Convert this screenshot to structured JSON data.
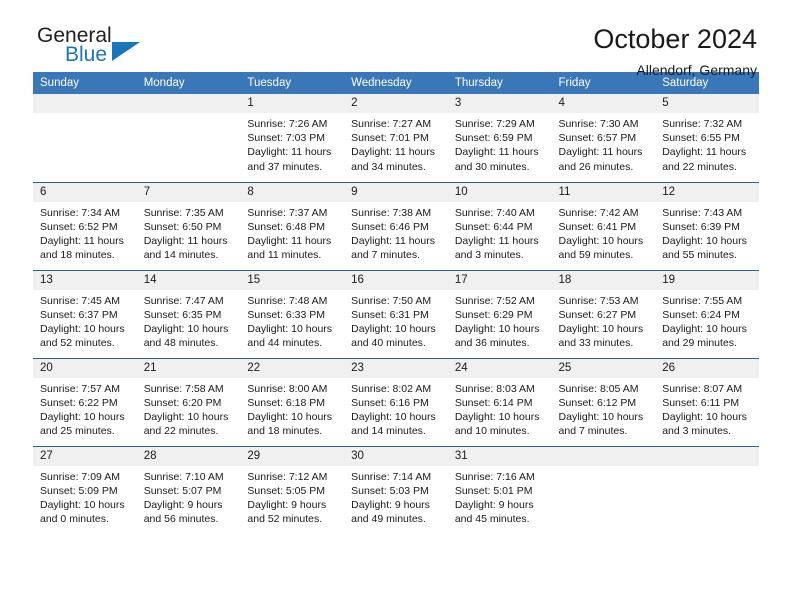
{
  "brand": {
    "name_part1": "General",
    "name_part2": "Blue",
    "accent_color": "#1b75bb",
    "triangle_icon": "triangle-icon"
  },
  "header": {
    "title": "October 2024",
    "subtitle": "Allendorf, Germany"
  },
  "calendar": {
    "header_background": "#3a77b8",
    "weekday_headers": [
      "Sunday",
      "Monday",
      "Tuesday",
      "Wednesday",
      "Thursday",
      "Friday",
      "Saturday"
    ],
    "weeks": [
      [
        {
          "day": "",
          "sunrise": "",
          "sunset": "",
          "daylight": "",
          "empty": true
        },
        {
          "day": "",
          "sunrise": "",
          "sunset": "",
          "daylight": "",
          "empty": true
        },
        {
          "day": "1",
          "sunrise": "Sunrise: 7:26 AM",
          "sunset": "Sunset: 7:03 PM",
          "daylight": "Daylight: 11 hours and 37 minutes."
        },
        {
          "day": "2",
          "sunrise": "Sunrise: 7:27 AM",
          "sunset": "Sunset: 7:01 PM",
          "daylight": "Daylight: 11 hours and 34 minutes."
        },
        {
          "day": "3",
          "sunrise": "Sunrise: 7:29 AM",
          "sunset": "Sunset: 6:59 PM",
          "daylight": "Daylight: 11 hours and 30 minutes."
        },
        {
          "day": "4",
          "sunrise": "Sunrise: 7:30 AM",
          "sunset": "Sunset: 6:57 PM",
          "daylight": "Daylight: 11 hours and 26 minutes."
        },
        {
          "day": "5",
          "sunrise": "Sunrise: 7:32 AM",
          "sunset": "Sunset: 6:55 PM",
          "daylight": "Daylight: 11 hours and 22 minutes."
        }
      ],
      [
        {
          "day": "6",
          "sunrise": "Sunrise: 7:34 AM",
          "sunset": "Sunset: 6:52 PM",
          "daylight": "Daylight: 11 hours and 18 minutes."
        },
        {
          "day": "7",
          "sunrise": "Sunrise: 7:35 AM",
          "sunset": "Sunset: 6:50 PM",
          "daylight": "Daylight: 11 hours and 14 minutes."
        },
        {
          "day": "8",
          "sunrise": "Sunrise: 7:37 AM",
          "sunset": "Sunset: 6:48 PM",
          "daylight": "Daylight: 11 hours and 11 minutes."
        },
        {
          "day": "9",
          "sunrise": "Sunrise: 7:38 AM",
          "sunset": "Sunset: 6:46 PM",
          "daylight": "Daylight: 11 hours and 7 minutes."
        },
        {
          "day": "10",
          "sunrise": "Sunrise: 7:40 AM",
          "sunset": "Sunset: 6:44 PM",
          "daylight": "Daylight: 11 hours and 3 minutes."
        },
        {
          "day": "11",
          "sunrise": "Sunrise: 7:42 AM",
          "sunset": "Sunset: 6:41 PM",
          "daylight": "Daylight: 10 hours and 59 minutes."
        },
        {
          "day": "12",
          "sunrise": "Sunrise: 7:43 AM",
          "sunset": "Sunset: 6:39 PM",
          "daylight": "Daylight: 10 hours and 55 minutes."
        }
      ],
      [
        {
          "day": "13",
          "sunrise": "Sunrise: 7:45 AM",
          "sunset": "Sunset: 6:37 PM",
          "daylight": "Daylight: 10 hours and 52 minutes."
        },
        {
          "day": "14",
          "sunrise": "Sunrise: 7:47 AM",
          "sunset": "Sunset: 6:35 PM",
          "daylight": "Daylight: 10 hours and 48 minutes."
        },
        {
          "day": "15",
          "sunrise": "Sunrise: 7:48 AM",
          "sunset": "Sunset: 6:33 PM",
          "daylight": "Daylight: 10 hours and 44 minutes."
        },
        {
          "day": "16",
          "sunrise": "Sunrise: 7:50 AM",
          "sunset": "Sunset: 6:31 PM",
          "daylight": "Daylight: 10 hours and 40 minutes."
        },
        {
          "day": "17",
          "sunrise": "Sunrise: 7:52 AM",
          "sunset": "Sunset: 6:29 PM",
          "daylight": "Daylight: 10 hours and 36 minutes."
        },
        {
          "day": "18",
          "sunrise": "Sunrise: 7:53 AM",
          "sunset": "Sunset: 6:27 PM",
          "daylight": "Daylight: 10 hours and 33 minutes."
        },
        {
          "day": "19",
          "sunrise": "Sunrise: 7:55 AM",
          "sunset": "Sunset: 6:24 PM",
          "daylight": "Daylight: 10 hours and 29 minutes."
        }
      ],
      [
        {
          "day": "20",
          "sunrise": "Sunrise: 7:57 AM",
          "sunset": "Sunset: 6:22 PM",
          "daylight": "Daylight: 10 hours and 25 minutes."
        },
        {
          "day": "21",
          "sunrise": "Sunrise: 7:58 AM",
          "sunset": "Sunset: 6:20 PM",
          "daylight": "Daylight: 10 hours and 22 minutes."
        },
        {
          "day": "22",
          "sunrise": "Sunrise: 8:00 AM",
          "sunset": "Sunset: 6:18 PM",
          "daylight": "Daylight: 10 hours and 18 minutes."
        },
        {
          "day": "23",
          "sunrise": "Sunrise: 8:02 AM",
          "sunset": "Sunset: 6:16 PM",
          "daylight": "Daylight: 10 hours and 14 minutes."
        },
        {
          "day": "24",
          "sunrise": "Sunrise: 8:03 AM",
          "sunset": "Sunset: 6:14 PM",
          "daylight": "Daylight: 10 hours and 10 minutes."
        },
        {
          "day": "25",
          "sunrise": "Sunrise: 8:05 AM",
          "sunset": "Sunset: 6:12 PM",
          "daylight": "Daylight: 10 hours and 7 minutes."
        },
        {
          "day": "26",
          "sunrise": "Sunrise: 8:07 AM",
          "sunset": "Sunset: 6:11 PM",
          "daylight": "Daylight: 10 hours and 3 minutes."
        }
      ],
      [
        {
          "day": "27",
          "sunrise": "Sunrise: 7:09 AM",
          "sunset": "Sunset: 5:09 PM",
          "daylight": "Daylight: 10 hours and 0 minutes."
        },
        {
          "day": "28",
          "sunrise": "Sunrise: 7:10 AM",
          "sunset": "Sunset: 5:07 PM",
          "daylight": "Daylight: 9 hours and 56 minutes."
        },
        {
          "day": "29",
          "sunrise": "Sunrise: 7:12 AM",
          "sunset": "Sunset: 5:05 PM",
          "daylight": "Daylight: 9 hours and 52 minutes."
        },
        {
          "day": "30",
          "sunrise": "Sunrise: 7:14 AM",
          "sunset": "Sunset: 5:03 PM",
          "daylight": "Daylight: 9 hours and 49 minutes."
        },
        {
          "day": "31",
          "sunrise": "Sunrise: 7:16 AM",
          "sunset": "Sunset: 5:01 PM",
          "daylight": "Daylight: 9 hours and 45 minutes."
        },
        {
          "day": "",
          "sunrise": "",
          "sunset": "",
          "daylight": "",
          "empty": true
        },
        {
          "day": "",
          "sunrise": "",
          "sunset": "",
          "daylight": "",
          "empty": true
        }
      ]
    ]
  }
}
